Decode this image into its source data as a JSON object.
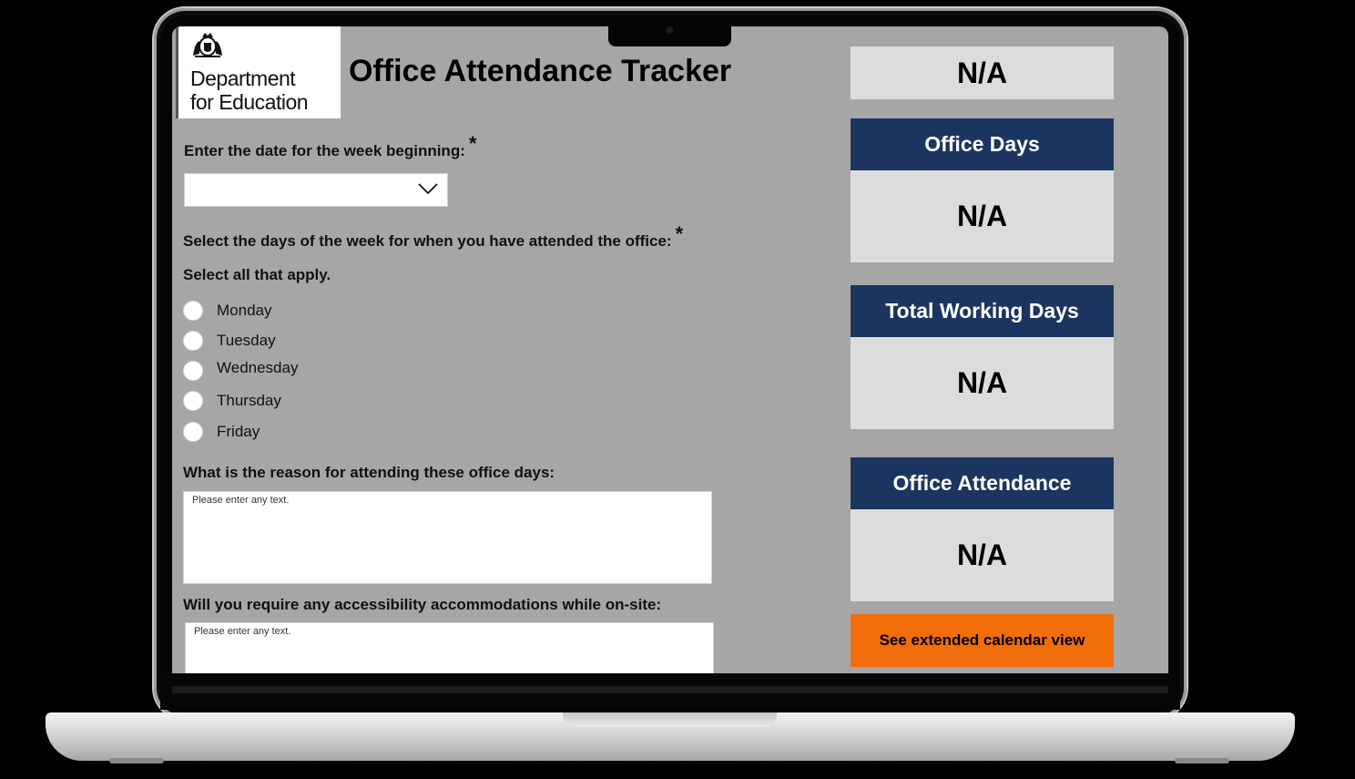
{
  "header": {
    "logo_lines": [
      "Department",
      "for Education"
    ],
    "title": "Office Attendance Tracker"
  },
  "form": {
    "date_question": "Enter the date for the week beginning:",
    "required_mark": "*",
    "date_value": "",
    "days_question": "Select the days of the week for when you have attended the office:",
    "days_hint": "Select all that apply.",
    "days": [
      "Monday",
      "Tuesday",
      "Wednesday",
      "Thursday",
      "Friday"
    ],
    "reason_question": "What is the reason for attending these office days:",
    "reason_placeholder": "Please enter any text.",
    "access_question": "Will you require any accessibility accommodations while on-site:",
    "access_placeholder": "Please enter any text."
  },
  "summary": {
    "top_value": "N/A",
    "cards": [
      {
        "label": "Office Days",
        "value": "N/A"
      },
      {
        "label": "Total Working Days",
        "value": "N/A"
      },
      {
        "label": "Office Attendance",
        "value": "N/A"
      }
    ],
    "calendar_button": "See extended calendar view"
  },
  "colors": {
    "screen_bg": "#a6a6a6",
    "card_header": "#1c3560",
    "card_body": "#dcdcdc",
    "accent_orange": "#f06e0a"
  }
}
